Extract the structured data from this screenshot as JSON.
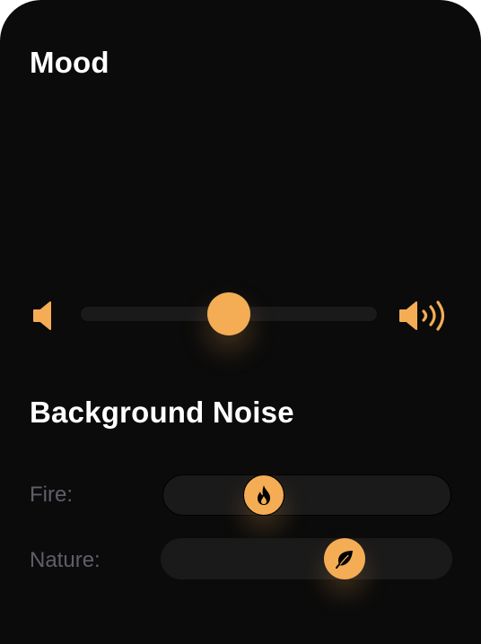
{
  "mood": {
    "title": "Mood",
    "volume_low_icon": "speaker-low-icon",
    "volume_high_icon": "speaker-high-icon",
    "level": 0.5
  },
  "background_noise": {
    "title": "Background Noise",
    "items": [
      {
        "label": "Fire:",
        "icon": "flame-icon",
        "level": 0.35
      },
      {
        "label": "Nature:",
        "icon": "leaf-icon",
        "level": 0.63
      }
    ]
  },
  "colors": {
    "background": "#0b0b0b",
    "accent": "#f4ad55",
    "track": "#1a1a1a",
    "label": "#5f5f6a",
    "text": "#ffffff"
  }
}
